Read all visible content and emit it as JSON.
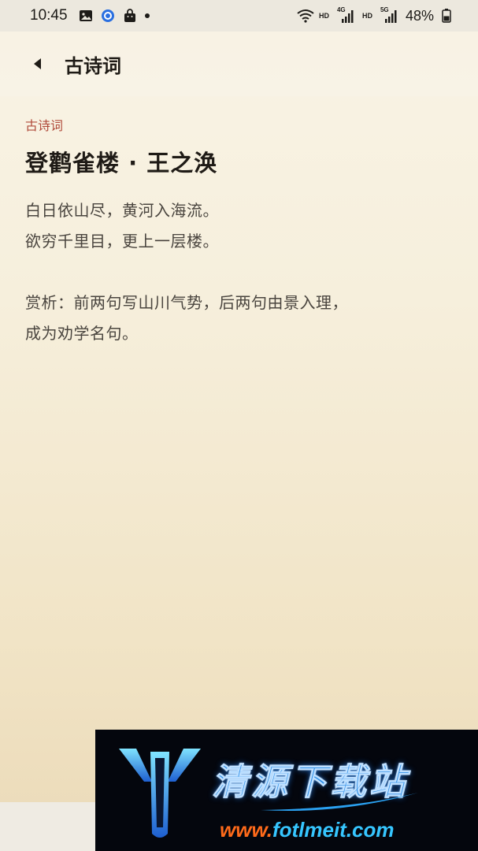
{
  "status_bar": {
    "time": "10:45",
    "battery": "48%",
    "icons": [
      "gallery-icon",
      "messaging-icon",
      "shopping-bag-icon",
      "more-dot-icon",
      "wifi-icon",
      "hd-label",
      "4g-signal-icon",
      "hd-label",
      "5g-signal-icon",
      "battery-icon"
    ],
    "hd_label": "HD",
    "net_4g": "4G",
    "net_5g": "5G"
  },
  "header": {
    "back_icon": "back-arrow-icon",
    "title": "古诗词"
  },
  "poem": {
    "category": "古诗词",
    "title": "登鹳雀楼 · 王之涣",
    "lines": [
      "白日依山尽，黄河入海流。",
      "欲穷千里目，更上一层楼。"
    ],
    "analysis_lines": [
      "赏析：前两句写山川气势，后两句由景入理，",
      "成为劝学名句。"
    ]
  },
  "watermark": {
    "title": "清源下载站",
    "url_part1": "www.",
    "url_part2": "fotlmeit.com"
  },
  "colors": {
    "category_red": "#b04a3a",
    "background_cream": "#f6efdc",
    "text_dark": "#1f1b16",
    "text_body": "#4a453f"
  }
}
